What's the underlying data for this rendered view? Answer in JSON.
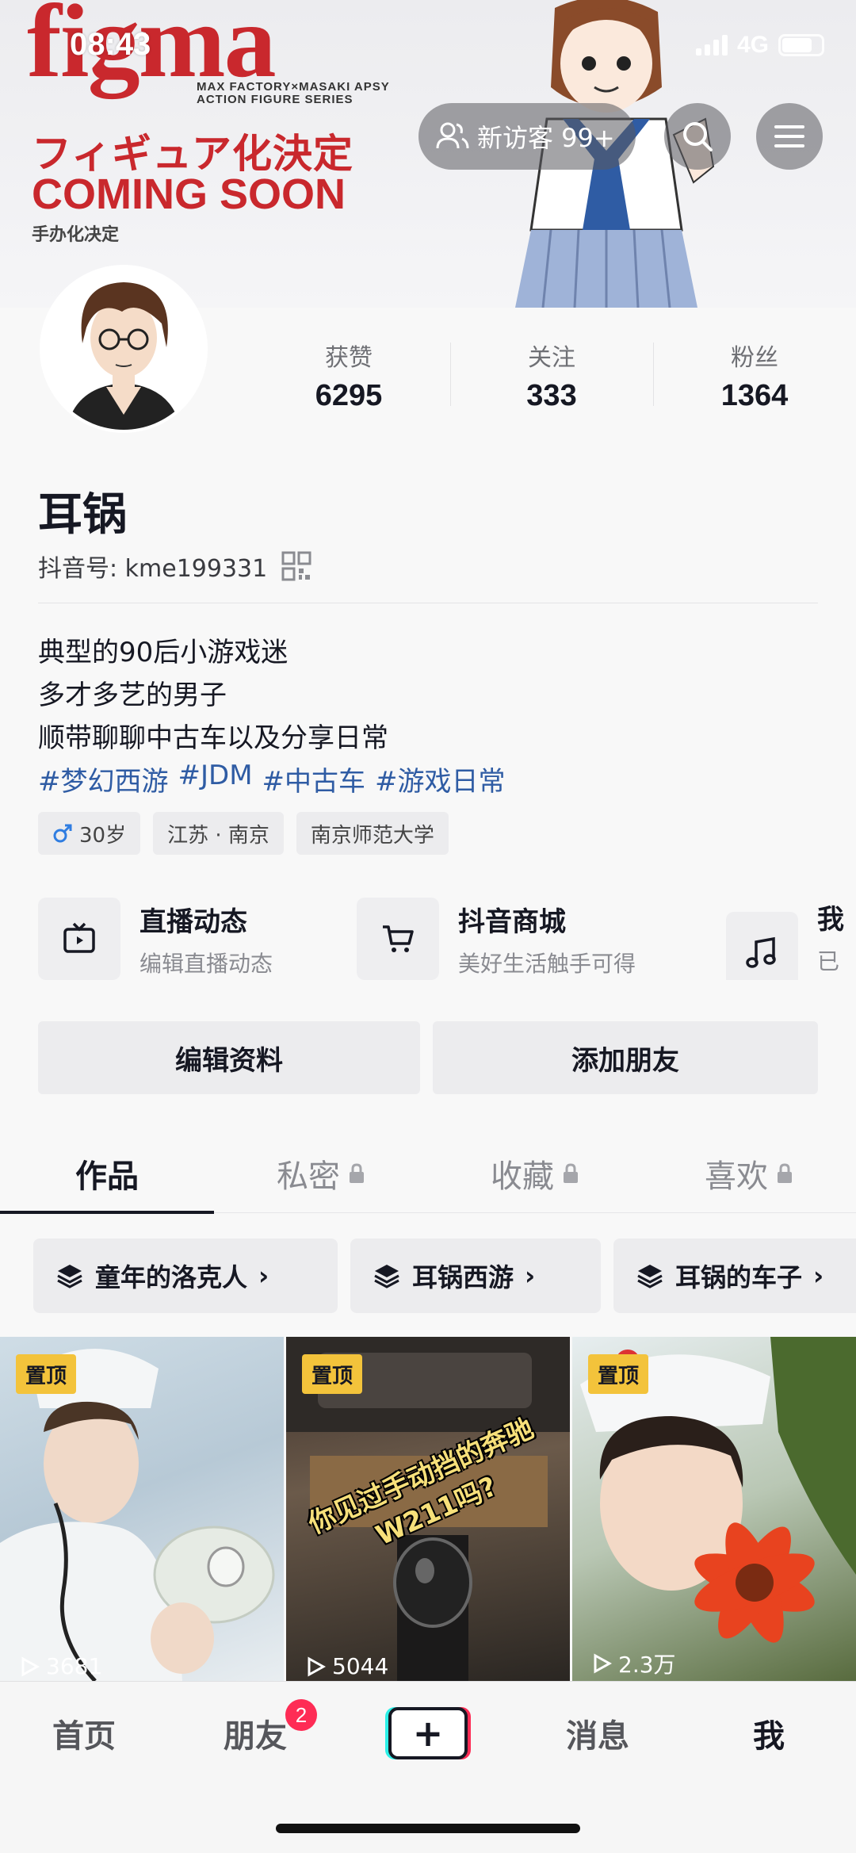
{
  "status_bar": {
    "time": "08:43",
    "network": "4G"
  },
  "banner": {
    "brand": "figma",
    "subline1": "MAX FACTORY×MASAKI APSY",
    "subline2": "ACTION FIGURE SERIES",
    "jp_text": "フィギュア化決定",
    "coming": "COMING SOON",
    "cn_text": "手办化决定"
  },
  "header": {
    "visitors_label": "新访客 99+"
  },
  "stats": [
    {
      "label": "获赞",
      "value": "6295"
    },
    {
      "label": "关注",
      "value": "333"
    },
    {
      "label": "粉丝",
      "value": "1364"
    }
  ],
  "profile": {
    "nickname": "耳锅",
    "douyin_id": "抖音号: kme199331",
    "bio": [
      "典型的90后小游戏迷",
      "多才多艺的男子",
      "顺带聊聊中古车以及分享日常"
    ],
    "hashtags": [
      "#梦幻西游",
      "#JDM",
      "#中古车",
      "#游戏日常"
    ],
    "tags": [
      {
        "label": "30岁",
        "icon": "male-icon"
      },
      {
        "label": "江苏 · 南京"
      },
      {
        "label": "南京师范大学"
      }
    ]
  },
  "features": [
    {
      "title": "直播动态",
      "subtitle": "编辑直播动态",
      "icon": "tv-icon"
    },
    {
      "title": "抖音商城",
      "subtitle": "美好生活触手可得",
      "icon": "cart-icon"
    },
    {
      "title": "我",
      "subtitle": "已收",
      "icon": "music-note-icon"
    }
  ],
  "actions": {
    "edit_profile": "编辑资料",
    "add_friend": "添加朋友"
  },
  "tabs": [
    {
      "label": "作品",
      "active": true,
      "locked": false
    },
    {
      "label": "私密",
      "active": false,
      "locked": true
    },
    {
      "label": "收藏",
      "active": false,
      "locked": true
    },
    {
      "label": "喜欢",
      "active": false,
      "locked": true
    }
  ],
  "collections": [
    "童年的洛克人",
    "耳锅西游",
    "耳锅的车子"
  ],
  "videos": [
    {
      "pinned": "置顶",
      "views": "3681"
    },
    {
      "pinned": "置顶",
      "views": "5044",
      "overlay_line1": "你见过手动挡的奔驰",
      "overlay_line2": "W211吗?"
    },
    {
      "pinned": "置顶",
      "views": "2.3万"
    }
  ],
  "bottom_nav": {
    "home": "首页",
    "friends": "朋友",
    "friends_badge": "2",
    "messages": "消息",
    "me": "我"
  },
  "colors": {
    "accent_red": "#fe2c55",
    "accent_cyan": "#2cf0e7",
    "hashtag_blue": "#2f5ca4",
    "pin_yellow": "#f3c33b"
  }
}
